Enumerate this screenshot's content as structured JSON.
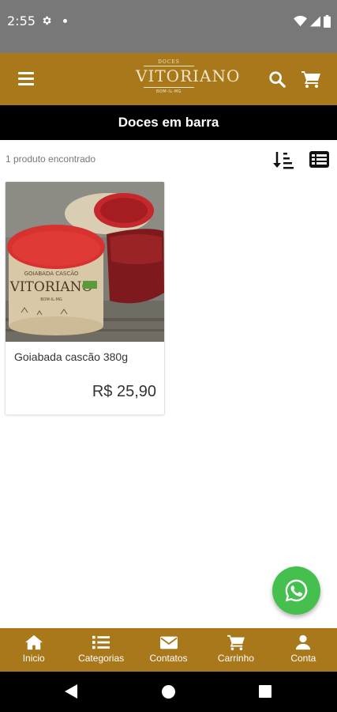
{
  "status_bar": {
    "time": "2:55",
    "icons": [
      "gear-icon",
      "notification-dot-icon",
      "wifi-icon",
      "signal-icon",
      "battery-icon"
    ]
  },
  "header": {
    "logo_small": "DOCES",
    "logo_main": "VITORIANO",
    "logo_sub": "BOM-IL-MG",
    "icons": [
      "menu-icon",
      "search-icon",
      "cart-icon"
    ]
  },
  "category": {
    "title": "Doces em barra"
  },
  "results": {
    "count_text": "1 produto encontrado",
    "icons": [
      "sort-icon",
      "list-view-icon"
    ]
  },
  "products": [
    {
      "name": "Goiabada cascão 380g",
      "price": "R$  25,90",
      "image_label_top": "GOIABADA CASCÃO",
      "image_label_brand": "VITORIANO",
      "image_label_sub": "BOM-IL-MG"
    }
  ],
  "bottom_nav": {
    "items": [
      {
        "label": "Inicio",
        "icon": "home-icon"
      },
      {
        "label": "Categorias",
        "icon": "list-icon"
      },
      {
        "label": "Contatos",
        "icon": "envelope-icon"
      },
      {
        "label": "Carrinho",
        "icon": "cart-icon"
      },
      {
        "label": "Conta",
        "icon": "user-icon"
      }
    ]
  },
  "colors": {
    "brand": "#a9781b",
    "whatsapp": "#45c04f",
    "status_bar": "#787878",
    "title_bar": "#000000"
  }
}
